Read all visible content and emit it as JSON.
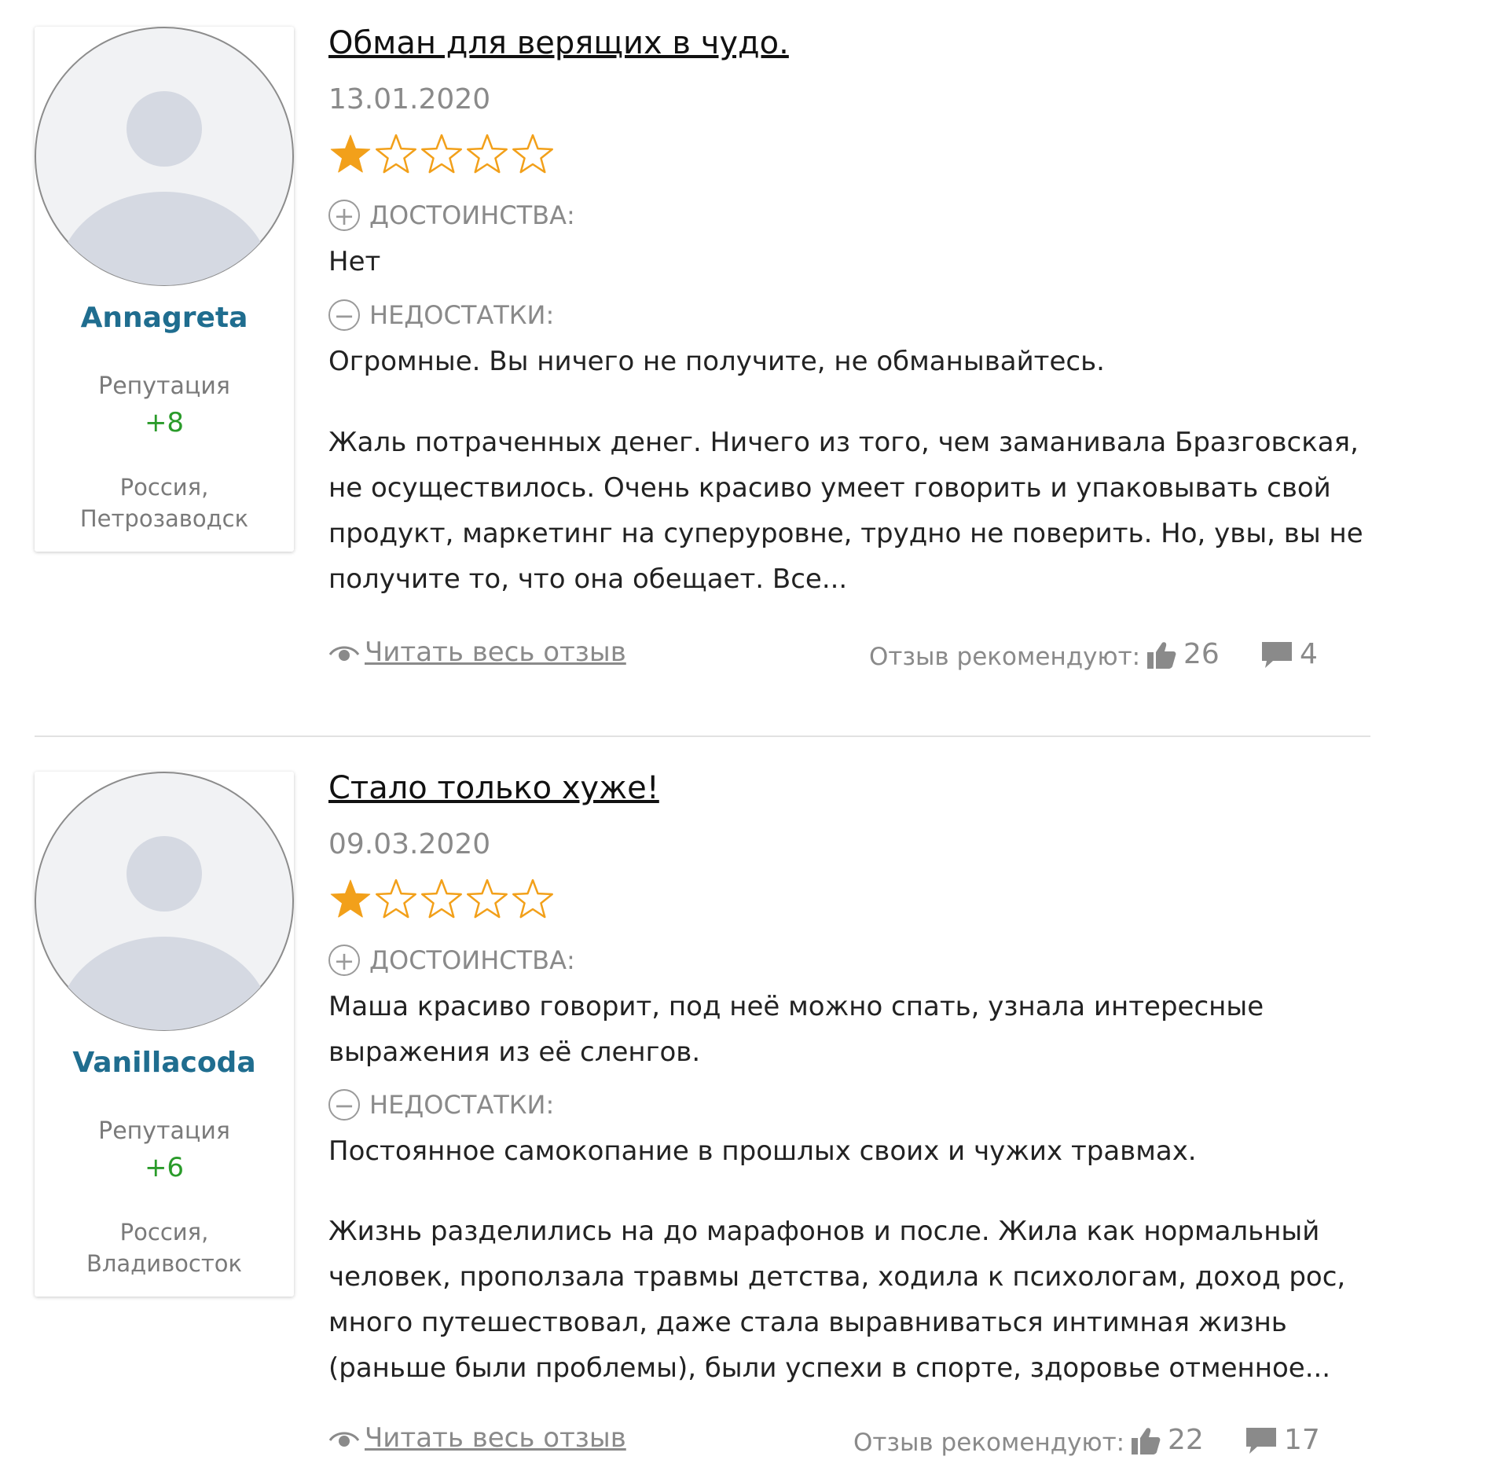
{
  "colors": {
    "username": "#1f6d8f",
    "reputation": "#2a9b2a",
    "star_filled": "#f2a01a",
    "muted": "#8a8a8a"
  },
  "labels": {
    "pros": "ДОСТОИНСТВА:",
    "cons": "НЕДОСТАТКИ:",
    "reputation": "Репутация",
    "read_more": "Читать весь отзыв",
    "recommend": "Отзыв рекомендуют:"
  },
  "reviews": [
    {
      "user": {
        "name": "Annagreta",
        "reputation": "+8",
        "location_line1": "Россия,",
        "location_line2": "Петрозаводск"
      },
      "title": "Обман для верящих в чудо.",
      "date": "13.01.2020",
      "rating": 1,
      "rating_max": 5,
      "pros": "Нет",
      "cons": "Огромные. Вы ничего не получите, не обманывайтесь.",
      "body": "Жаль потраченных денег. Ничего из того, чем заманивала Бразговская, не осуществилось. Очень красиво умеет говорить и упаковывать свой продукт, маркетинг на суперуровне, трудно не поверить. Но, увы, вы не получите то, что она обещает. Все...",
      "likes": "26",
      "comments": "4"
    },
    {
      "user": {
        "name": "Vanillacoda",
        "reputation": "+6",
        "location_line1": "Россия,",
        "location_line2": "Владивосток"
      },
      "title": "Стало только хуже!",
      "date": "09.03.2020",
      "rating": 1,
      "rating_max": 5,
      "pros": "Маша красиво говорит, под неё можно спать, узнала интересные выражения из её сленгов.",
      "cons": "Постоянное самокопание в прошлых своих и чужих травмах.",
      "body": "Жизнь разделились на до марафонов и после. Жила как нормальный человек, проползала травмы детства, ходила к психологам, доход рос, много путешествовал, даже стала выравниваться интимная жизнь (раньше были проблемы), были успехи в спорте, здоровье отменное...",
      "likes": "22",
      "comments": "17"
    }
  ]
}
